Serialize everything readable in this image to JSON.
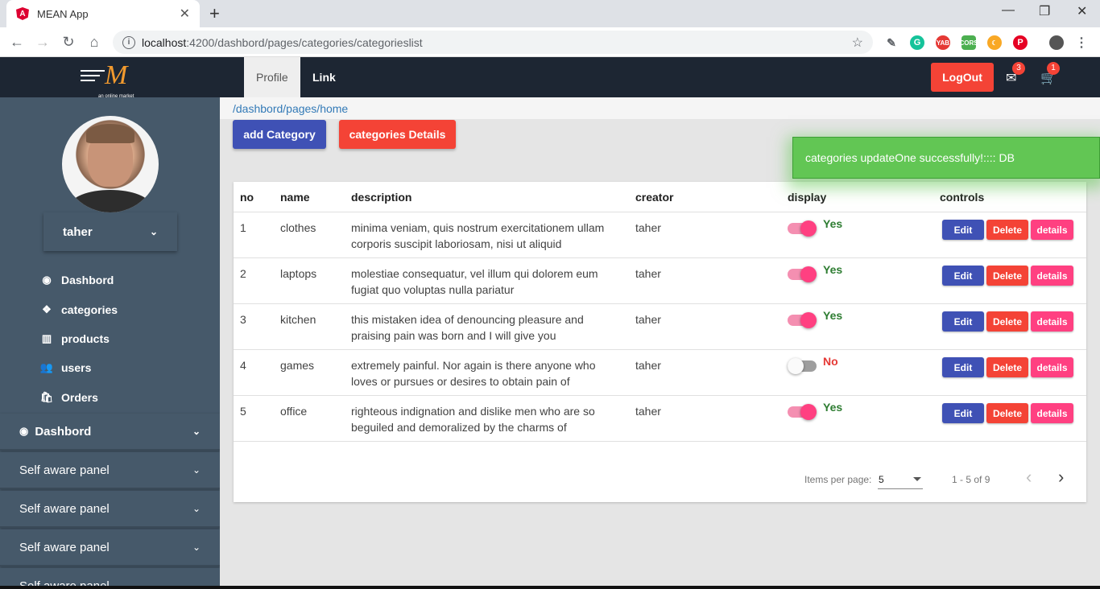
{
  "browser": {
    "tab_title": "MEAN App",
    "url_host": "localhost",
    "url_path": ":4200/dashbord/pages/categories/categorieslist"
  },
  "header": {
    "logo_tagline": "an online market",
    "nav": [
      "Profile",
      "Link"
    ],
    "logout_label": "LogOut",
    "mail_badge": "3",
    "cart_badge": "1"
  },
  "sidebar": {
    "username": "taher",
    "links": [
      {
        "icon": "dashboard-icon",
        "label": "Dashbord"
      },
      {
        "icon": "cubes-icon",
        "label": "categories"
      },
      {
        "icon": "barcode-icon",
        "label": "products"
      },
      {
        "icon": "users-icon",
        "label": "users"
      },
      {
        "icon": "shopping-bag-icon",
        "label": "Orders"
      }
    ],
    "panels": [
      "Dashbord",
      "Self aware panel",
      "Self aware panel",
      "Self aware panel",
      "Self aware panel"
    ]
  },
  "main": {
    "breadcrumb": "/dashbord/pages/home",
    "add_button": "add Category",
    "details_button": "categories Details",
    "columns": [
      "no",
      "name",
      "description",
      "creator",
      "display",
      "controls"
    ],
    "rows": [
      {
        "no": "1",
        "name": "clothes",
        "desc1": "minima veniam, quis nostrum exercitationem ullam",
        "desc2": "corporis suscipit laboriosam, nisi ut aliquid",
        "creator": "taher",
        "display": "Yes",
        "on": true
      },
      {
        "no": "2",
        "name": "laptops",
        "desc1": "molestiae consequatur, vel illum qui dolorem eum",
        "desc2": "fugiat quo voluptas nulla pariatur",
        "creator": "taher",
        "display": "Yes",
        "on": true
      },
      {
        "no": "3",
        "name": "kitchen",
        "desc1": "this mistaken idea of denouncing pleasure and",
        "desc2": "praising pain was born and I will give you",
        "creator": "taher",
        "display": "Yes",
        "on": true
      },
      {
        "no": "4",
        "name": "games",
        "desc1": "extremely painful. Nor again is there anyone who",
        "desc2": "loves or pursues or desires to obtain pain of",
        "creator": "taher",
        "display": "No",
        "on": false
      },
      {
        "no": "5",
        "name": "office",
        "desc1": "righteous indignation and dislike men who are so",
        "desc2": "beguiled and demoralized by the charms of",
        "creator": "taher",
        "display": "Yes",
        "on": true
      }
    ],
    "row_actions": {
      "edit": "Edit",
      "delete": "Delete",
      "details": "details"
    },
    "paginator": {
      "label": "Items per page:",
      "page_size": "5",
      "range": "1 - 5 of 9"
    }
  },
  "toast": "categories updateOne successfully!:::: DB",
  "colors": {
    "header_bg": "#1d2633",
    "sidebar_bg": "#46596a",
    "primary": "#3f51b5",
    "danger": "#f44336",
    "pink": "#ff4081",
    "success": "#62c654",
    "yes": "#2e7d32",
    "no": "#e53935"
  }
}
